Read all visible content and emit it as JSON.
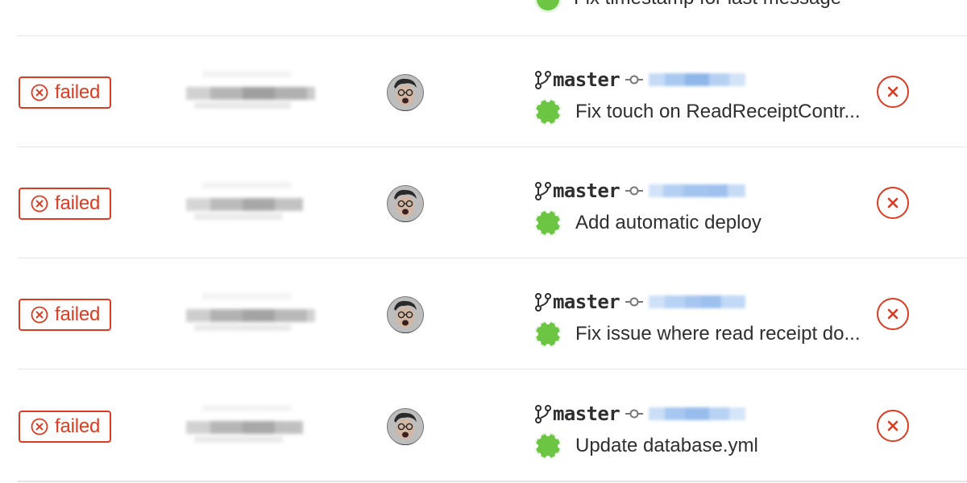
{
  "colors": {
    "failed": "#db3b21",
    "text": "#2e2e2e",
    "divider": "#e5e5e5",
    "identicon": "#6cc644"
  },
  "top_partial_row": {
    "commit_title": "Fix timestamp for last message"
  },
  "pipelines": [
    {
      "status_label": "failed",
      "status_icon": "status-failed-icon",
      "branch": "master",
      "commit_title": "Fix touch on ReadReceiptContr...",
      "action_icon": "cancel-icon"
    },
    {
      "status_label": "failed",
      "status_icon": "status-failed-icon",
      "branch": "master",
      "commit_title": "Add automatic deploy",
      "action_icon": "cancel-icon"
    },
    {
      "status_label": "failed",
      "status_icon": "status-failed-icon",
      "branch": "master",
      "commit_title": "Fix issue where read receipt do...",
      "action_icon": "cancel-icon"
    },
    {
      "status_label": "failed",
      "status_icon": "status-failed-icon",
      "branch": "master",
      "commit_title": "Update database.yml",
      "action_icon": "cancel-icon"
    }
  ]
}
